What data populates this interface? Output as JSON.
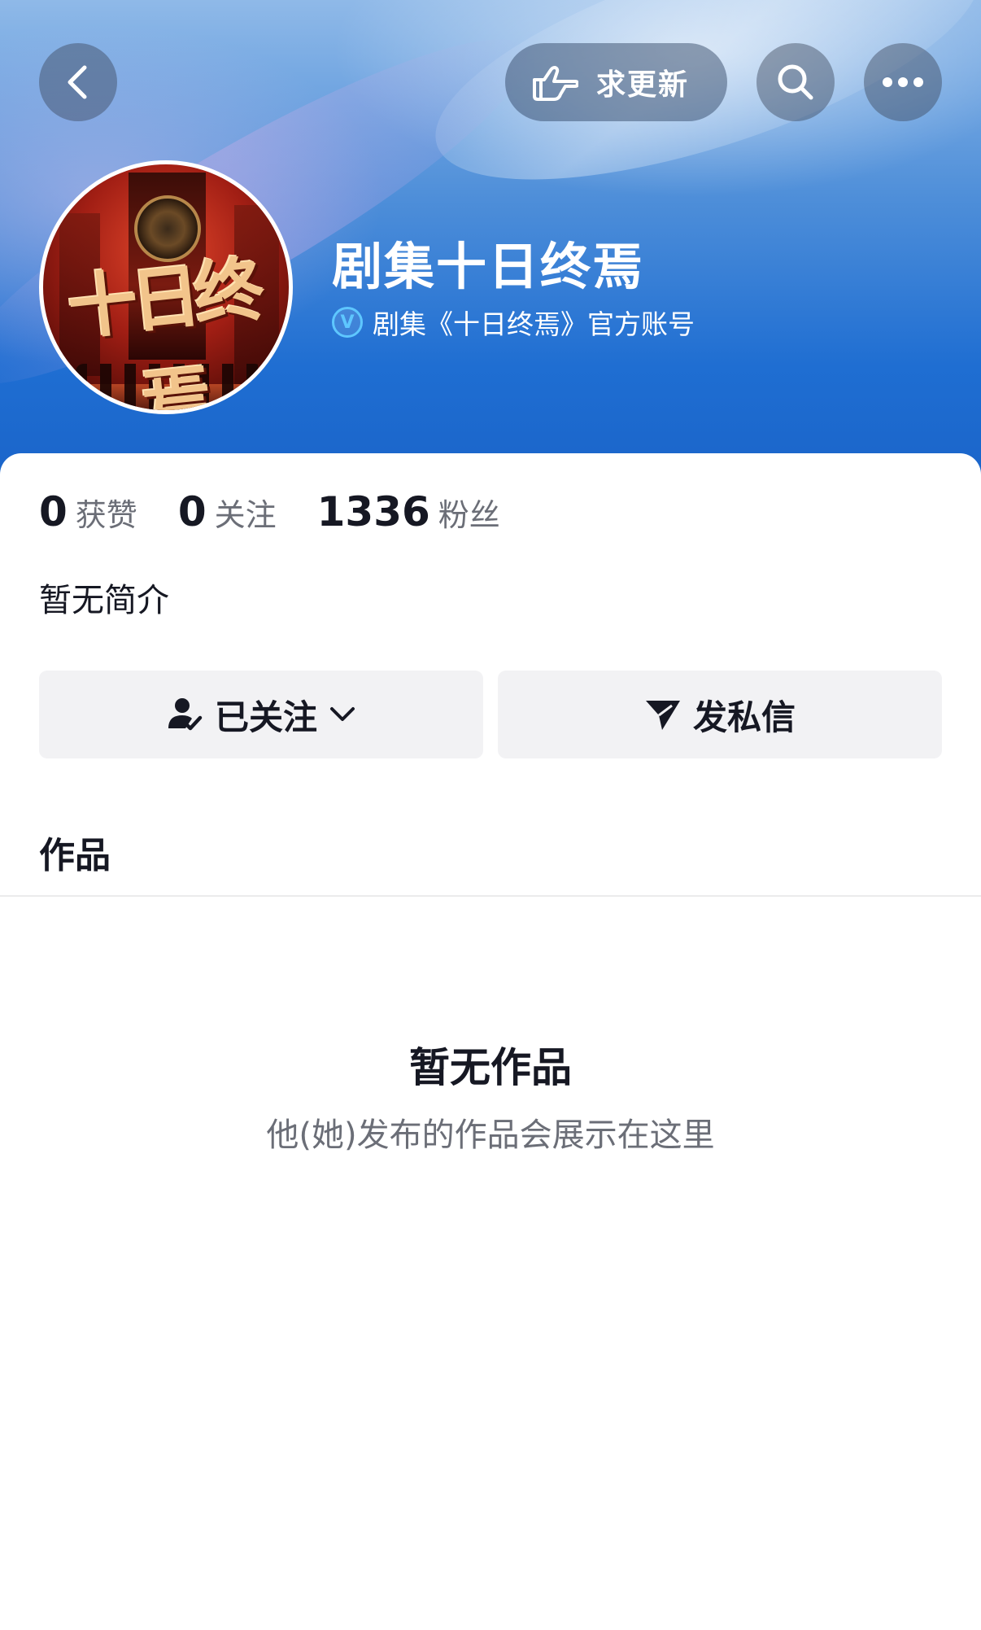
{
  "header": {
    "request_update_label": "求更新",
    "name": "剧集十日终焉",
    "verified_desc": "剧集《十日终焉》官方账号",
    "verified_icon": "V",
    "avatar_logo": "十日终焉"
  },
  "stats": [
    {
      "value": "0",
      "label": "获赞"
    },
    {
      "value": "0",
      "label": "关注"
    },
    {
      "value": "1336",
      "label": "粉丝"
    }
  ],
  "bio": "暂无简介",
  "actions": {
    "followed_label": "已关注",
    "message_label": "发私信"
  },
  "tabs": {
    "works_label": "作品"
  },
  "empty": {
    "title": "暂无作品",
    "subtitle": "他(她)发布的作品会展示在这里"
  },
  "icons": {
    "back": "chevron-left-icon",
    "request": "pointing-hand-icon",
    "search": "search-icon",
    "more": "more-dots-icon",
    "followed": "user-check-icon",
    "dropdown": "chevron-down-icon",
    "message": "send-icon",
    "verified": "verified-badge-icon"
  },
  "colors": {
    "header_blue": "#1f6ed2",
    "verified": "#5ec7ff",
    "button_bg": "#f2f2f4",
    "text_primary": "#161823",
    "text_secondary": "#6b6e77"
  }
}
